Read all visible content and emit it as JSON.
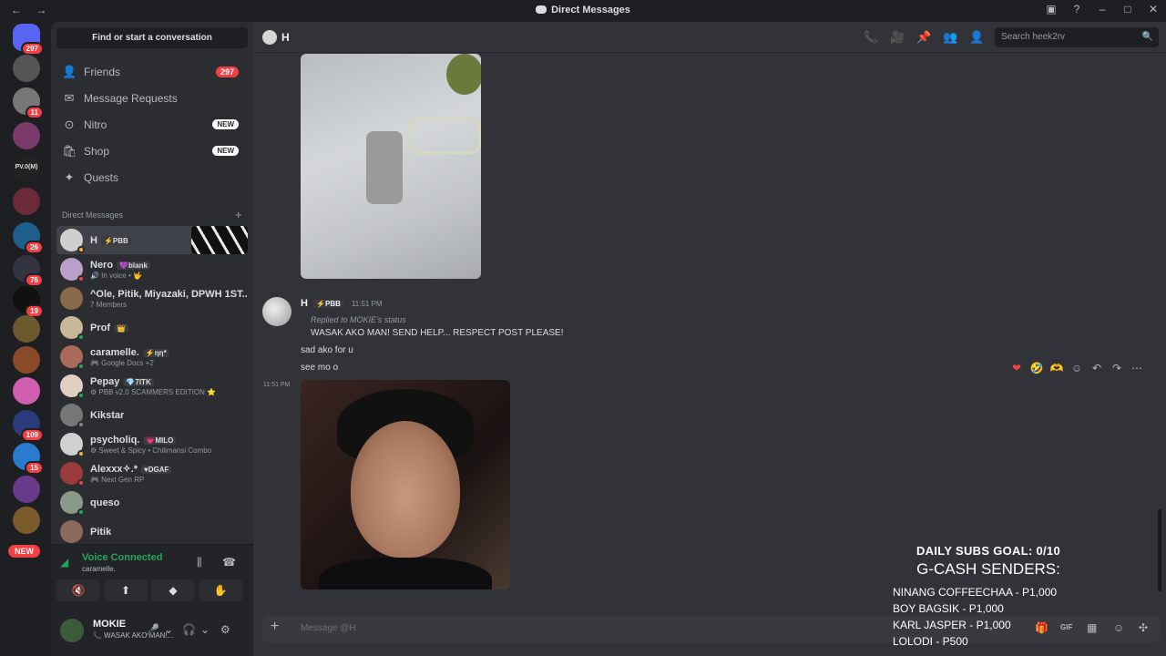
{
  "titlebar": {
    "nav": "← →",
    "title": "Direct Messages",
    "buttons": [
      "▣",
      "?",
      "–",
      "□",
      "✕"
    ]
  },
  "guilds": [
    {
      "badge": "297",
      "color": "#5865f2"
    },
    {
      "badge": "",
      "color": "#555"
    },
    {
      "badge": "11",
      "color": "#777"
    },
    {
      "badge": "",
      "color": "#7a3b6b"
    },
    {
      "badge": "",
      "color": "#222",
      "label": "PV.0(M)"
    },
    {
      "badge": "",
      "color": "#6a2a3a"
    },
    {
      "badge": "26",
      "color": "#1d5f8a"
    },
    {
      "badge": "76",
      "color": "#334"
    },
    {
      "badge": "19",
      "color": "#111"
    },
    {
      "badge": "",
      "color": "#6b5a2e"
    },
    {
      "badge": "",
      "color": "#8a4a2a"
    },
    {
      "badge": "",
      "color": "#d05fb0"
    },
    {
      "badge": "109",
      "color": "#2a3a7a"
    },
    {
      "badge": "15",
      "color": "#2a7ad0"
    },
    {
      "badge": "",
      "color": "#6a3a8a"
    },
    {
      "badge": "",
      "color": "#7a5a2a"
    }
  ],
  "guild_new": "NEW",
  "sidebar": {
    "search_label": "Find or start a conversation",
    "nav": [
      {
        "label": "Friends",
        "icon": "👤",
        "badge": "297",
        "badge_type": "count"
      },
      {
        "label": "Message Requests",
        "icon": "✉",
        "badge": "",
        "badge_type": ""
      },
      {
        "label": "Nitro",
        "icon": "⊙",
        "badge": "NEW",
        "badge_type": "new"
      },
      {
        "label": "Shop",
        "icon": "🛍",
        "badge": "NEW",
        "badge_type": "new"
      },
      {
        "label": "Quests",
        "icon": "✦",
        "badge": "",
        "badge_type": ""
      }
    ],
    "dm_header": "Direct Messages",
    "dm_add": "+",
    "dms": [
      {
        "name": "H",
        "tag": "⚡PBB",
        "sub": "",
        "color": "#cfcfcf",
        "status": "#f0b232",
        "active": true
      },
      {
        "name": "Nero",
        "tag": "💜blank",
        "sub": "🔊 In voice • 🤟",
        "color": "#b8a0c8",
        "status": "#f23f43"
      },
      {
        "name": "^Ole, Pitik, Miyazaki, DPWH 1ST...",
        "tag": "",
        "sub": "7 Members",
        "color": "#8a6a4a",
        "status": ""
      },
      {
        "name": "Prof",
        "tag": "👑",
        "sub": "",
        "color": "#c8b89a",
        "status": "#23a55a"
      },
      {
        "name": "caramelle.",
        "tag": "⚡ηη*",
        "sub": "🎮 Google Docs +2",
        "color": "#a86a5a",
        "status": "#23a55a"
      },
      {
        "name": "Pepay",
        "tag": "💎7ITK",
        "sub": "⚙ PBB v2.0 SCAMMERS EDITION ⭐",
        "color": "#e0d0c0",
        "status": "#23a55a"
      },
      {
        "name": "Kikstar",
        "tag": "",
        "sub": "",
        "color": "#777",
        "status": "#80848e"
      },
      {
        "name": "psycholiq.",
        "tag": "💗MILO",
        "sub": "⚙ Sweet & Spicy • Chilimansi Combo",
        "color": "#d0d0d0",
        "status": "#f0b232"
      },
      {
        "name": "Alexxx✧.*",
        "tag": "♥DGAF",
        "sub": "🎮 Next Gen RP",
        "color": "#9a3a3a",
        "status": "#f23f43"
      },
      {
        "name": "queso",
        "tag": "",
        "sub": "",
        "color": "#8a9a8a",
        "status": "#23a55a"
      },
      {
        "name": "Pitik",
        "tag": "",
        "sub": "",
        "color": "#8a6a5a",
        "status": ""
      }
    ],
    "voice": {
      "status": "Voice Connected",
      "channel": "caramelle.",
      "controls": [
        "🔇",
        "⬆",
        "◆",
        "✋"
      ]
    },
    "user": {
      "name": "MOKIE",
      "status": "📞 WASAK AKO MAN!...",
      "controls": [
        "🎤",
        "⌄",
        "🎧",
        "⌄",
        "⚙"
      ]
    }
  },
  "header": {
    "name": "H",
    "icons": [
      "📞",
      "🎥",
      "📌",
      "👥",
      "👤"
    ],
    "search_placeholder": "Search heek2rv",
    "search_icon": "🔍"
  },
  "messages": {
    "author": "H",
    "author_tag": "⚡PBB",
    "time": "11:51 PM",
    "reply_label": "Replied to MOKIE's status",
    "reply_text": "WASAK AKO MAN! SEND HELP... RESPECT POST PLEASE!",
    "lines": [
      "sad ako for u",
      "see mo o"
    ],
    "gutter_time": "11:51 PM",
    "reactions": [
      "❤",
      "🤣",
      "🫶"
    ],
    "actions": [
      "☺",
      "↶",
      "↷",
      "⋯"
    ]
  },
  "composer": {
    "placeholder": "Message @H",
    "plus": "+",
    "icons": [
      "🎁",
      "GIF",
      "▦",
      "☺",
      "✣"
    ]
  },
  "overlay": {
    "goal": "DAILY SUBS GOAL: 0/10",
    "title": "G-CASH SENDERS:",
    "donors": [
      "NINANG COFFEECHAA - P1,000",
      "BOY BAGSIK - P1,000",
      "KARL JASPER - P1,000",
      "LOLODI - P500"
    ]
  }
}
